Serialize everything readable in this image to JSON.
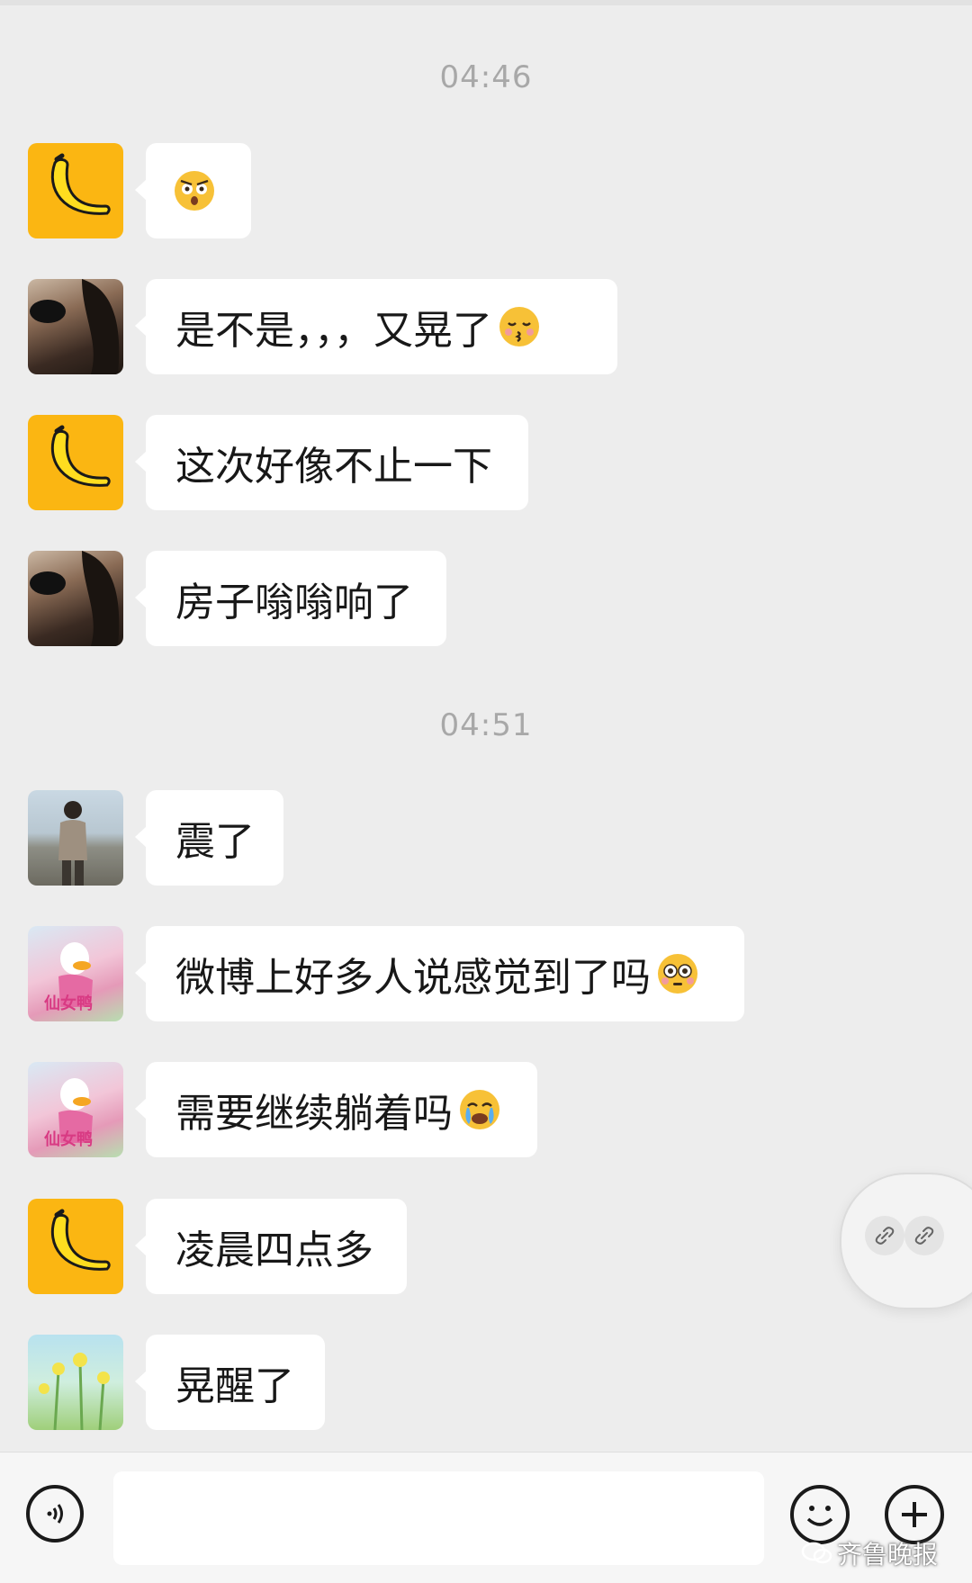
{
  "timestamps": [
    "04:46",
    "04:51"
  ],
  "messages": [
    {
      "avatar": "banana",
      "text": "",
      "emoji": "shocked-face-emoji"
    },
    {
      "avatar": "sunglasses-woman",
      "text": "是不是，，，又晃了",
      "emoji": "kissing-face-emoji"
    },
    {
      "avatar": "banana",
      "text": "这次好像不止一下",
      "emoji": ""
    },
    {
      "avatar": "sunglasses-woman",
      "text": "房子嗡嗡响了",
      "emoji": ""
    },
    {
      "avatar": "man-at-beach",
      "text": "震了",
      "emoji": ""
    },
    {
      "avatar": "fairy-duck",
      "text": "微博上好多人说感觉到了吗",
      "emoji": "flushed-face-emoji"
    },
    {
      "avatar": "fairy-duck",
      "text": "需要继续躺着吗",
      "emoji": "crying-face-emoji"
    },
    {
      "avatar": "banana",
      "text": "凌晨四点多",
      "emoji": ""
    },
    {
      "avatar": "yellow-flowers",
      "text": "晃醒了",
      "emoji": ""
    }
  ],
  "avatar_labels": {
    "fairy_duck": "仙女鸭"
  },
  "watermark": "齐鲁晚报",
  "colors": {
    "banana_bg": "#fbb612",
    "bubble": "#ffffff",
    "background": "#ededed"
  }
}
